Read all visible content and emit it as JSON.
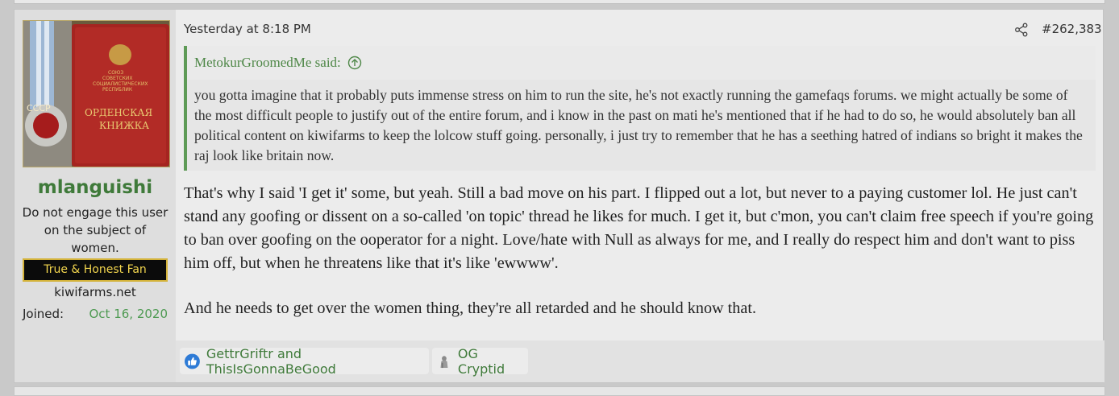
{
  "user": {
    "username": "mlanguishi",
    "title": "Do not engage this user on the subject of women.",
    "banner": "True & Honest Fan",
    "site": "kiwifarms.net",
    "joined_label": "Joined:",
    "joined_value": "Oct 16, 2020",
    "avatar_text": {
      "cccp": "СССР",
      "line1": "ОРДЕНСКАЯ",
      "line2": "КНИЖКА",
      "emblem1": "СОЮЗ",
      "emblem2": "СОВЕТСКИХ",
      "emblem3": "СОЦИАЛИСТИЧЕСКИХ",
      "emblem4": "РЕСПУБЛИК"
    }
  },
  "post": {
    "timestamp": "Yesterday at 8:18 PM",
    "number": "#262,383",
    "quote": {
      "author": "MetokurGroomedMe said:",
      "text": "you gotta imagine that it probably puts immense stress on him to run the site, he's not exactly running the gamefaqs forums. we might actually be some of the most difficult people to justify out of the entire forum, and i know in the past on mati he's mentioned that if he had to do so, he would absolutely ban all political content on kiwifarms to keep the lolcow stuff going. personally, i just try to remember that he has a seething hatred of indians so bright it makes the raj look like britain now."
    },
    "paragraphs": [
      "That's why I said 'I get it' some, but yeah. Still a bad move on his part. I flipped out a lot, but never to a paying customer lol. He just can't stand any goofing or dissent on a so-called 'on topic' thread he likes for much. I get it, but c'mon, you can't claim free speech if you're going to ban over goofing on the ooperator for a night. Love/hate with Null as always for me, and I really do respect him and don't want to piss him off, but when he threatens like that it's like 'ewwww'.",
      "And he needs to get over the women thing, they're all retarded and he should know that."
    ]
  },
  "reactions": [
    {
      "icon": "like-icon",
      "label": "GettrGriftr and ThisIsGonnaBeGood"
    },
    {
      "icon": "cryptid-icon",
      "label": "OG Cryptid"
    }
  ],
  "colors": {
    "accent": "#4e8747",
    "username": "#3f7a3a",
    "banner_bg": "#0b0b0b",
    "banner_text": "#f2d54e",
    "like_blue": "#2e7bd6"
  }
}
